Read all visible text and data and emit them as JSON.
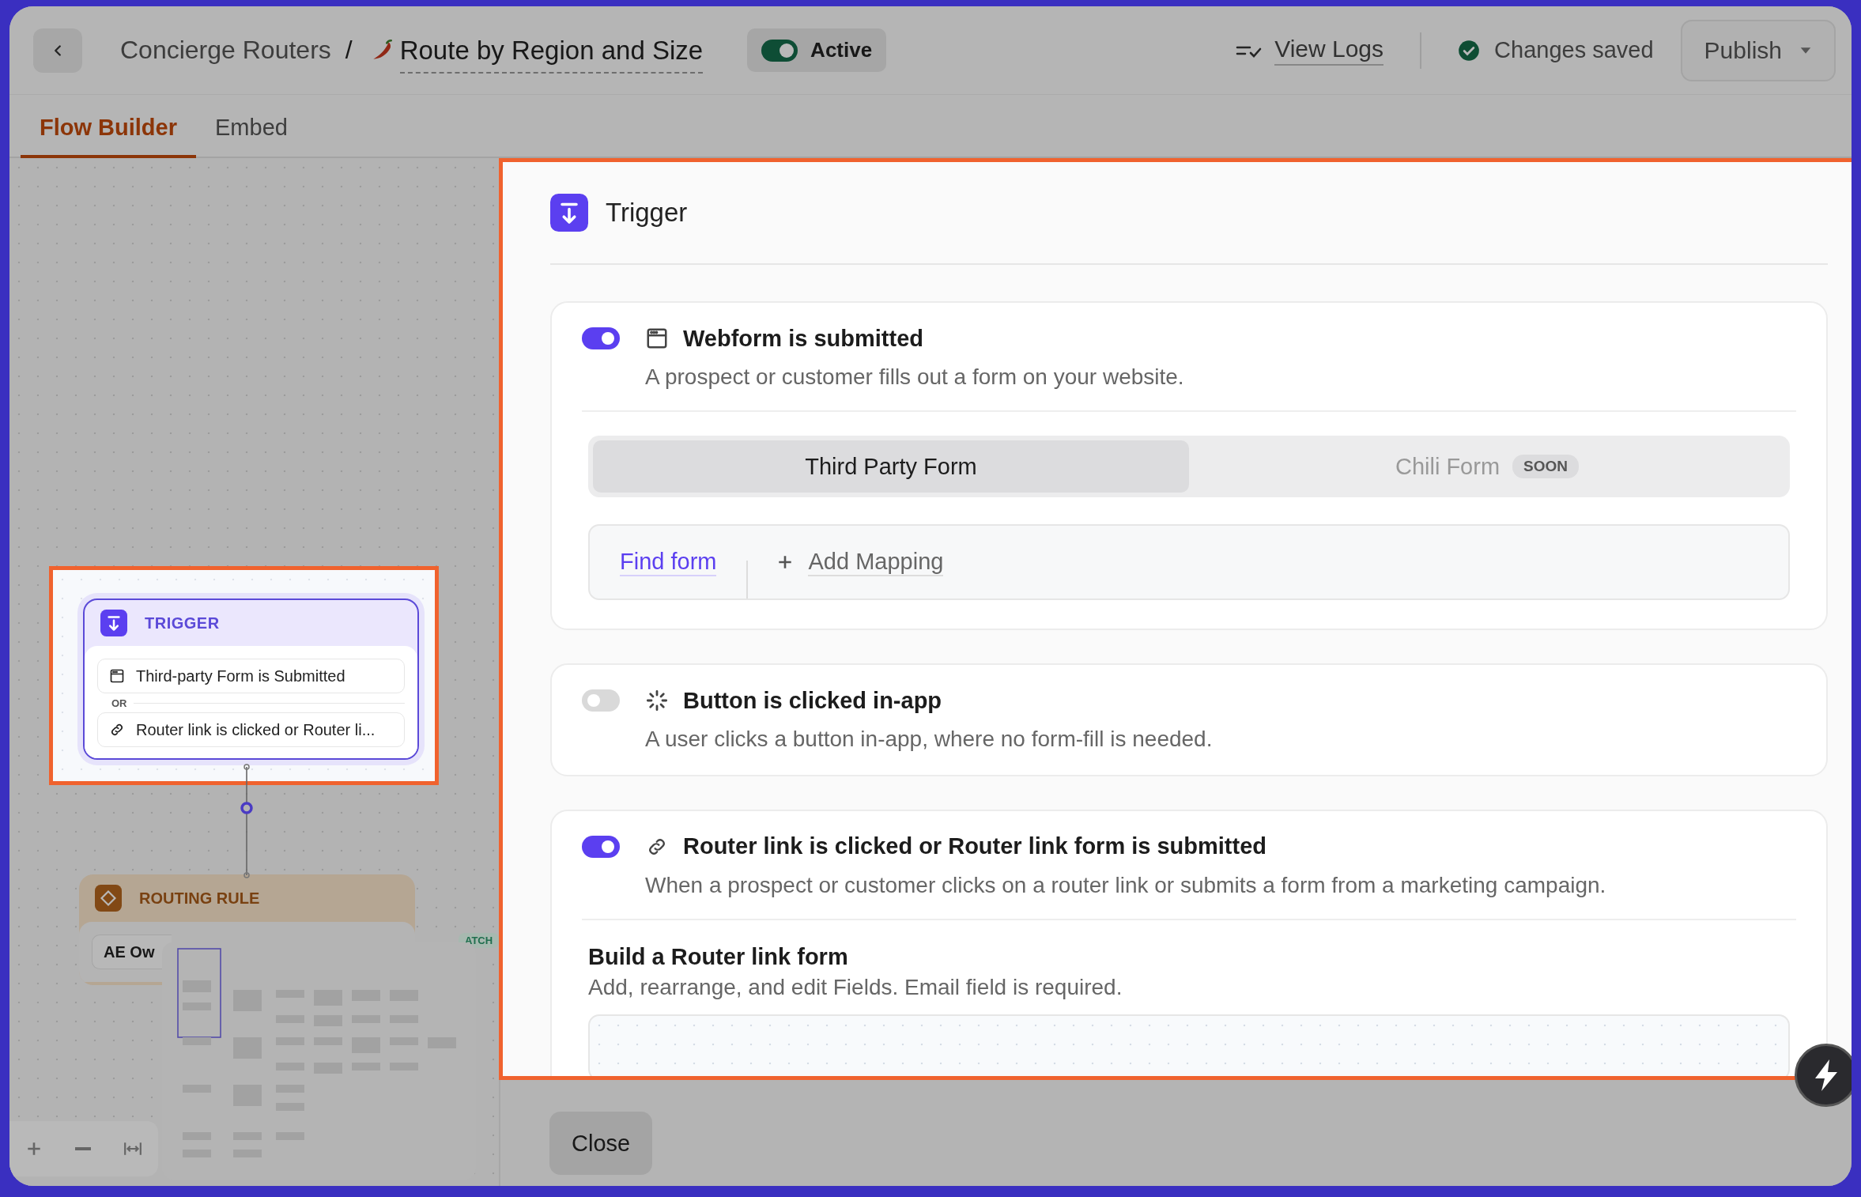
{
  "header": {
    "breadcrumb": "Concierge Routers",
    "separator": "/",
    "title": "Route by Region and Size",
    "status": {
      "label": "Active",
      "on": true
    },
    "view_logs": "View Logs",
    "save_status": "Changes saved",
    "publish": "Publish"
  },
  "tabs": [
    {
      "label": "Flow Builder",
      "selected": true
    },
    {
      "label": "Embed",
      "selected": false
    }
  ],
  "canvas": {
    "nodes": [
      {
        "kind": "trigger",
        "title": "TRIGGER",
        "spotlight": true,
        "separator": "OR",
        "items": [
          {
            "kind": "form",
            "label": "Third-party Form is Submitted"
          },
          {
            "kind": "link",
            "label": "Router link is clicked or Router li..."
          }
        ]
      },
      {
        "kind": "routing_rule",
        "title": "ROUTING RULE",
        "spotlight": false,
        "items": [
          {
            "label": "AE Ow"
          }
        ]
      }
    ],
    "edge_badge": "ATCH"
  },
  "panel": {
    "title": "Trigger",
    "spotlight": true,
    "triggers": [
      {
        "kind": "webform",
        "on": true,
        "title": "Webform is submitted",
        "description": "A prospect or customer fills out a form on your website.",
        "form_types": [
          {
            "label": "Third Party Form",
            "selected": true
          },
          {
            "label": "Chili Form",
            "selected": false,
            "badge": "SOON"
          }
        ],
        "find_form": "Find form",
        "add_mapping": "Add Mapping"
      },
      {
        "kind": "button",
        "on": false,
        "title": "Button is clicked in-app",
        "description": "A user clicks a button in-app, where no form-fill is needed."
      },
      {
        "kind": "link",
        "on": true,
        "title": "Router link is clicked or Router link form is submitted",
        "description": "When a prospect or customer clicks on a router link or submits a form from a marketing campaign.",
        "builder_title": "Build a Router link form",
        "builder_description": "Add, rearrange, and edit Fields. Email field is required."
      }
    ]
  },
  "footer": {
    "close": "Close"
  }
}
